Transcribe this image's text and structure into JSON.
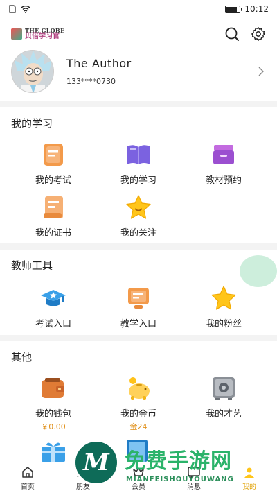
{
  "status_bar": {
    "time": "10:12",
    "battery_level": 0.85
  },
  "header": {
    "brand_en": "THE GLOBE",
    "brand_cn": "贝倍学习官",
    "icons": [
      "search-icon",
      "settings-icon"
    ]
  },
  "profile": {
    "name": "The Author",
    "phone": "133****0730"
  },
  "my_study": {
    "title": "我的学习",
    "items": [
      {
        "label": "我的考试",
        "icon": "exam-icon"
      },
      {
        "label": "我的学习",
        "icon": "book-icon"
      },
      {
        "label": "教材预约",
        "icon": "box-icon"
      },
      {
        "label": "我的证书",
        "icon": "certificate-icon"
      },
      {
        "label": "我的关注",
        "icon": "star-icon"
      }
    ]
  },
  "teacher_tools": {
    "title": "教师工具",
    "items": [
      {
        "label": "考试入口",
        "icon": "graduation-cap-icon"
      },
      {
        "label": "教学入口",
        "icon": "teaching-icon"
      },
      {
        "label": "我的粉丝",
        "icon": "star-icon"
      }
    ]
  },
  "others": {
    "title": "其他",
    "items": [
      {
        "label": "我的钱包",
        "sub": "￥0.00",
        "icon": "wallet-icon"
      },
      {
        "label": "我的金币",
        "sub": "金24",
        "icon": "piggy-bank-icon"
      },
      {
        "label": "我的才艺",
        "icon": "safe-icon"
      }
    ]
  },
  "nav": {
    "tabs": [
      {
        "label": "首页",
        "icon": "home-icon"
      },
      {
        "label": "朋友",
        "icon": "friends-icon"
      },
      {
        "label": "会员",
        "icon": "member-icon"
      },
      {
        "label": "消息",
        "icon": "message-icon"
      },
      {
        "label": "我的",
        "icon": "user-icon"
      }
    ]
  },
  "watermark": {
    "big": "免费手游网",
    "small": "MIANFEISHOUYOUWANG",
    "logo_letter": "M"
  },
  "colors": {
    "orange": "#f39a4a",
    "purple": "#7b62e0",
    "gold": "#ffc51a",
    "blue": "#3aa0e8"
  }
}
